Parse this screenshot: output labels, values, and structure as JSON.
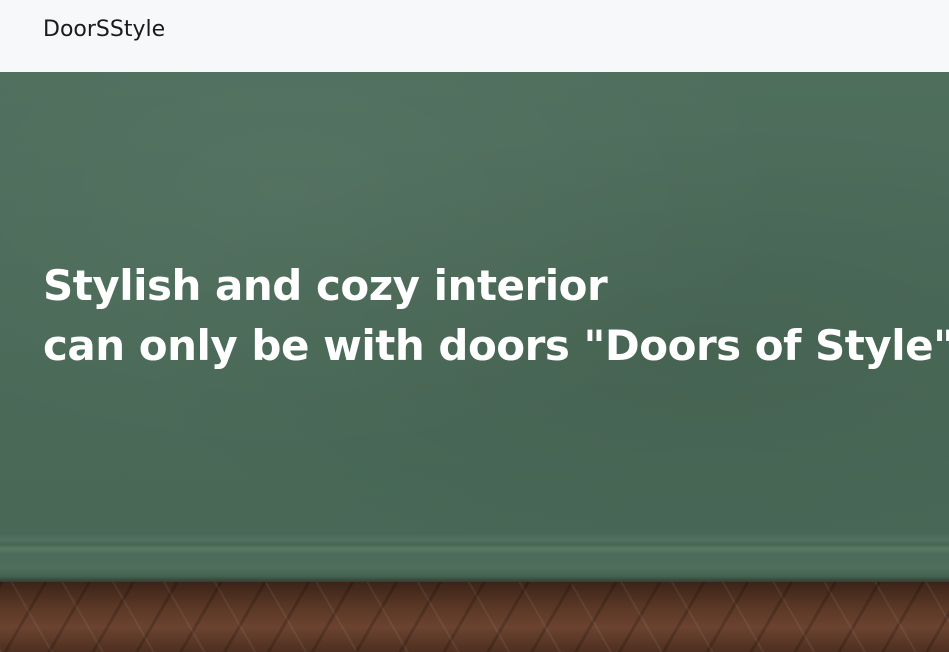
{
  "header": {
    "brand": "DoorSStyle"
  },
  "hero": {
    "line1": "Stylish and cozy interior",
    "line2": "can only be with doors \"Doors of Style\""
  },
  "colors": {
    "header_bg": "#f7f8fa",
    "wall": "#4b6a58",
    "floor": "#5a3725",
    "headline_text": "#ffffff"
  }
}
